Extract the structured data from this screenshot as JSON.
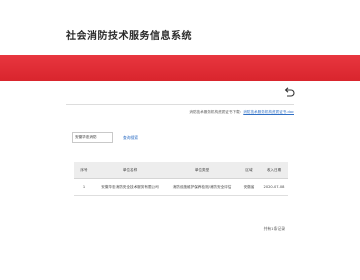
{
  "site": {
    "title": "社会消防技术服务信息系统"
  },
  "colors": {
    "banner": "#d9252d",
    "link": "#2f6fc5"
  },
  "icons": {
    "back": "return-arrow-icon"
  },
  "download": {
    "prefix": "消防技术服务机构资质证书下载：",
    "link_text": "消防技术服务机构资质证书.doc"
  },
  "search": {
    "value": "安徽华忠消防",
    "button_label": "查询搜索"
  },
  "table": {
    "headers": [
      "序号",
      "单位名称",
      "单位类型",
      "区域",
      "收入日期"
    ],
    "rows": [
      [
        "1",
        "安徽华忠消防安全技术服务有限公司",
        "消防设施维护保养检测/消防安全评估",
        "安徽省",
        "2020-07-08"
      ]
    ]
  },
  "pager": {
    "text": "共有1条记录"
  }
}
